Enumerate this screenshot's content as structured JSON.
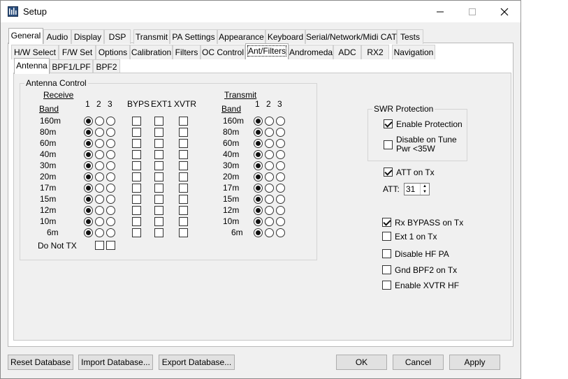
{
  "window": {
    "title": "Setup"
  },
  "tabs_main": [
    "General",
    "Audio",
    "Display",
    "DSP",
    "Transmit",
    "PA Settings",
    "Appearance",
    "Keyboard",
    "Serial/Network/Midi CAT",
    "Tests"
  ],
  "tabs_sub": [
    "H/W Select",
    "F/W Set",
    "Options",
    "Calibration",
    "Filters",
    "OC Control",
    "Ant/Filters",
    "Andromeda",
    "ADC",
    "RX2",
    "Navigation"
  ],
  "tabs_ant": [
    "Antenna",
    "BPF1/LPF",
    "BPF2"
  ],
  "antenna_control": {
    "title": "Antenna Control",
    "receive_label": "Receive",
    "transmit_label": "Transmit",
    "band_label": "Band",
    "col_1": "1",
    "col_2": "2",
    "col_3": "3",
    "byps_label": "BYPS",
    "ext1_label": "EXT1",
    "xvtr_label": "XVTR",
    "bands": [
      "160m",
      "80m",
      "60m",
      "40m",
      "30m",
      "20m",
      "17m",
      "15m",
      "12m",
      "10m",
      "6m"
    ],
    "do_not_tx_label": "Do Not TX"
  },
  "swr": {
    "title": "SWR Protection",
    "enable_label": "Enable Protection",
    "disable_tune_line1": "Disable on Tune",
    "disable_tune_line2": "Pwr <35W"
  },
  "att": {
    "att_on_tx_label": "ATT on Tx",
    "att_label": "ATT:",
    "att_value": "31"
  },
  "options": {
    "rx_bypass": "Rx BYPASS on Tx",
    "ext1": "Ext 1 on Tx",
    "disable_hf_pa": "Disable HF PA",
    "gnd_bpf2": "Gnd BPF2 on Tx",
    "enable_xvtr": "Enable XVTR HF"
  },
  "buttons": {
    "reset": "Reset Database",
    "import": "Import Database...",
    "export": "Export Database...",
    "ok": "OK",
    "cancel": "Cancel",
    "apply": "Apply"
  }
}
